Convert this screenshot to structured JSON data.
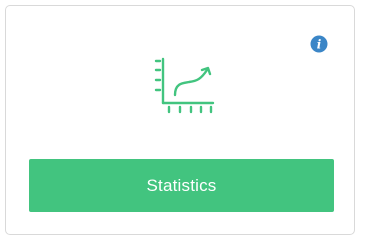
{
  "card": {
    "button_label": "Statistics",
    "chart_icon": "line-chart-trend-up-icon",
    "info_icon": "info-icon",
    "info_glyph": "i"
  },
  "colors": {
    "accent_green": "#42c47f",
    "info_blue": "#3b86c7",
    "border": "#d9d9d9"
  }
}
